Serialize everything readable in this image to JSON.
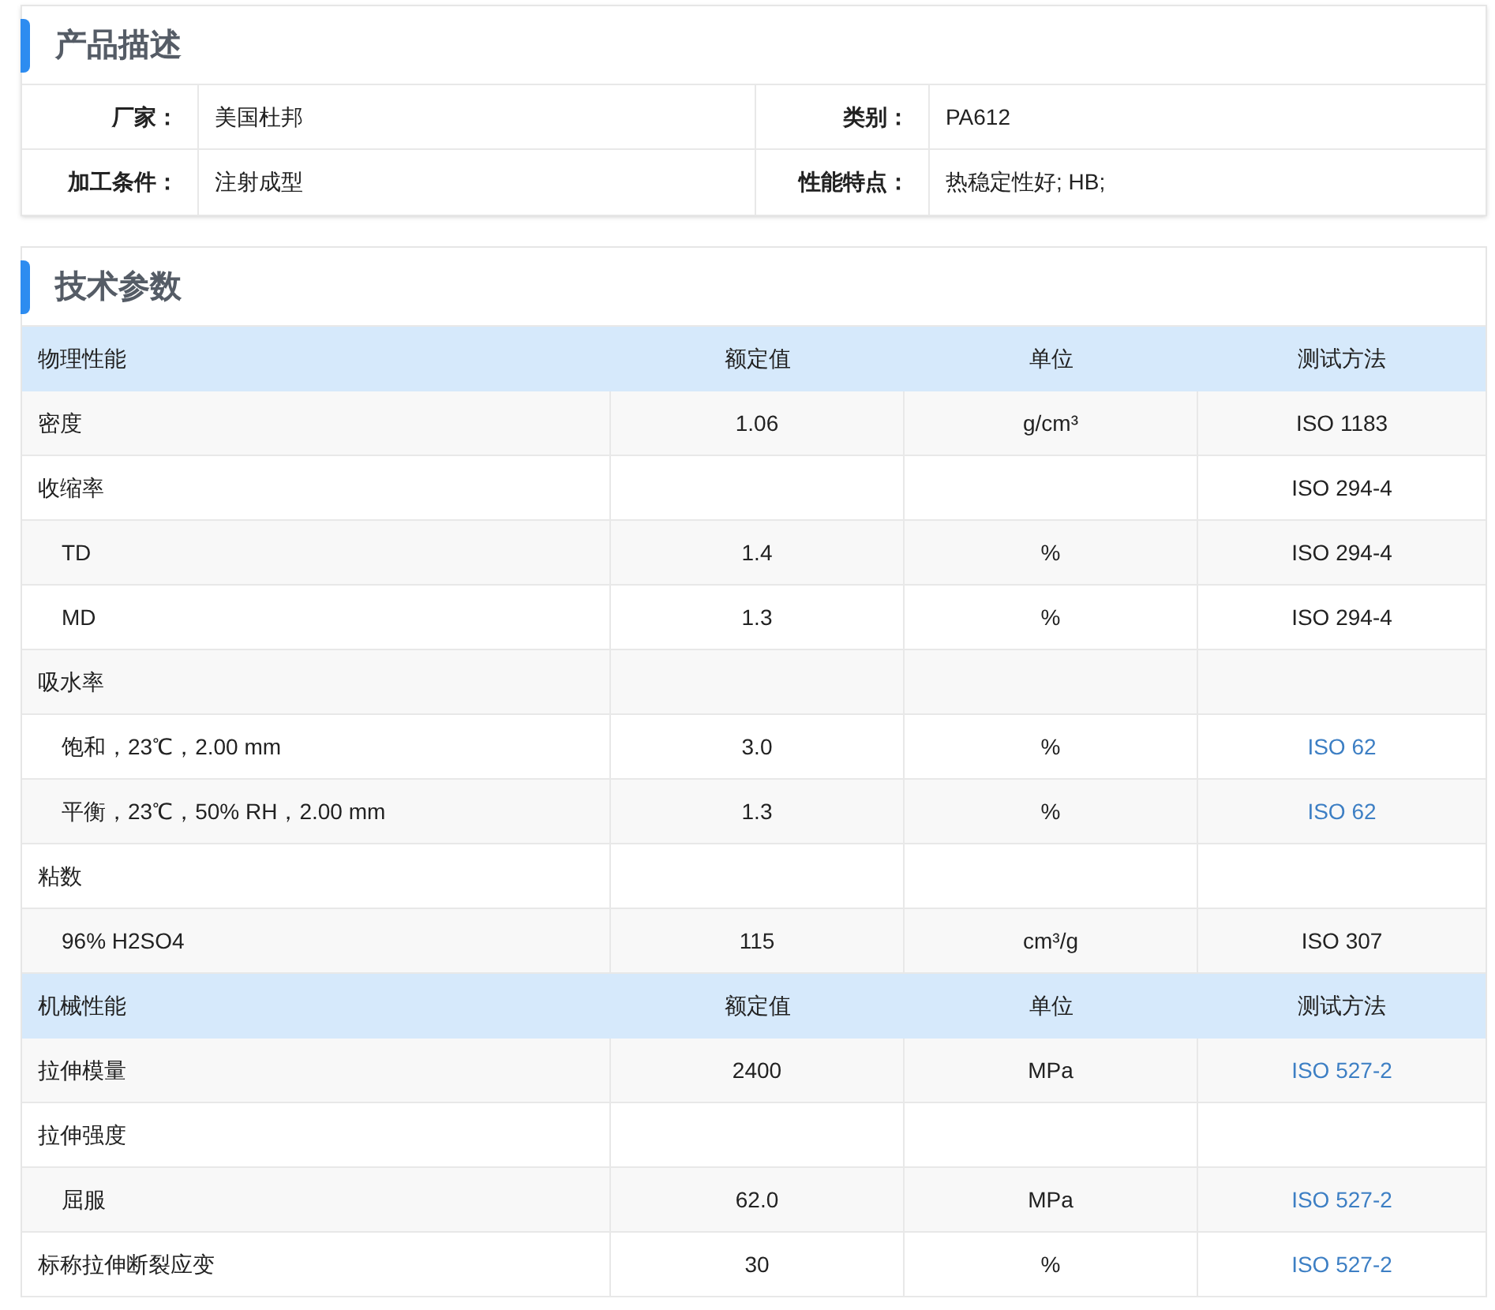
{
  "description": {
    "title": "产品描述",
    "rows": [
      [
        {
          "label": "厂家：",
          "value": "美国杜邦"
        },
        {
          "label": "类别：",
          "value": "PA612"
        }
      ],
      [
        {
          "label": "加工条件：",
          "value": "注射成型"
        },
        {
          "label": "性能特点：",
          "value": "热稳定性好; HB;"
        }
      ]
    ]
  },
  "specs": {
    "title": "技术参数",
    "groups": [
      {
        "header": {
          "name": "物理性能",
          "value": "额定值",
          "unit": "单位",
          "method": "测试方法"
        },
        "rows": [
          {
            "name": "密度",
            "value": "1.06",
            "unit": "g/cm³",
            "method": "ISO 1183",
            "method_link": false
          },
          {
            "name": "收缩率",
            "method": "ISO 294-4",
            "method_link": false,
            "children": [
              {
                "name": "TD",
                "value": "1.4",
                "unit": "%",
                "method": "ISO 294-4",
                "method_link": false
              },
              {
                "name": "MD",
                "value": "1.3",
                "unit": "%",
                "method": "ISO 294-4",
                "method_link": false
              }
            ]
          },
          {
            "name": "吸水率",
            "children": [
              {
                "name": "饱和，23℃，2.00 mm",
                "value": "3.0",
                "unit": "%",
                "method": "ISO 62",
                "method_link": true
              },
              {
                "name": "平衡，23℃，50% RH，2.00 mm",
                "value": "1.3",
                "unit": "%",
                "method": "ISO 62",
                "method_link": true
              }
            ]
          },
          {
            "name": "粘数",
            "children": [
              {
                "name": "96% H2SO4",
                "value": "115",
                "unit": "cm³/g",
                "method": "ISO 307",
                "method_link": false
              }
            ]
          }
        ]
      },
      {
        "header": {
          "name": "机械性能",
          "value": "额定值",
          "unit": "单位",
          "method": "测试方法"
        },
        "rows": [
          {
            "name": "拉伸模量",
            "value": "2400",
            "unit": "MPa",
            "method": "ISO 527-2",
            "method_link": true
          },
          {
            "name": "拉伸强度",
            "children": [
              {
                "name": "屈服",
                "value": "62.0",
                "unit": "MPa",
                "method": "ISO 527-2",
                "method_link": true
              }
            ]
          },
          {
            "name": "标称拉伸断裂应变",
            "value": "30",
            "unit": "%",
            "method": "ISO 527-2",
            "method_link": true
          }
        ]
      }
    ]
  }
}
